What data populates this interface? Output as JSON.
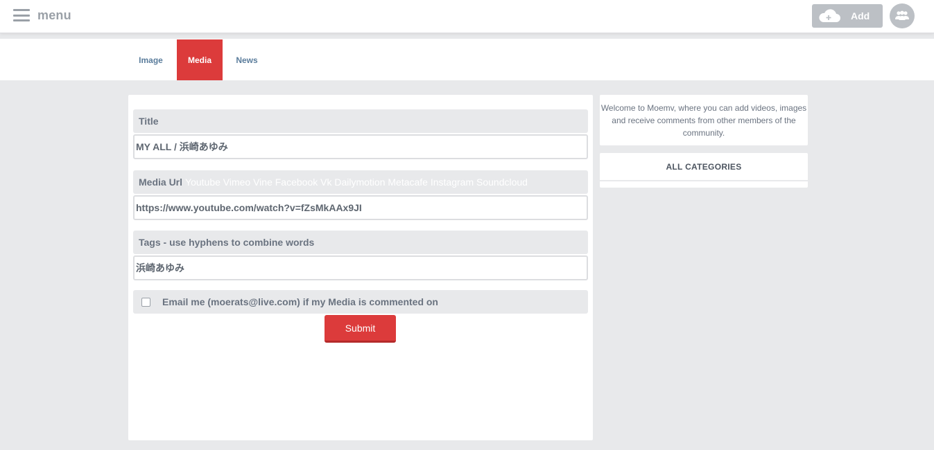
{
  "header": {
    "menu_label": "menu",
    "menu_icon": "hamburger-icon",
    "add_label": "Add",
    "add_icon": "cloud-plus-icon",
    "avatar_icon": "users-icon"
  },
  "tabs": [
    {
      "label": "Image",
      "active": false
    },
    {
      "label": "Media",
      "active": true
    },
    {
      "label": "News",
      "active": false
    }
  ],
  "form": {
    "title_label": "Title",
    "title_value": "MY ALL / 浜崎あゆみ",
    "media_url_label": "Media Url",
    "media_url_providers": "Youtube Vimeo Vine Facebook Vk Dailymotion Metacafe Instagram Soundcloud",
    "media_url_value": "https://www.youtube.com/watch?v=fZsMkAAx9JI",
    "tags_label": "Tags - use hyphens to combine words",
    "tags_value": "浜崎あゆみ",
    "email_label": "Email me (moerats@live.com) if my Media is commented on",
    "email_checked": false,
    "submit_label": "Submit"
  },
  "sidebar": {
    "welcome_text": "Welcome to Moemv, where you can add videos, images and receive comments from other members of the community.",
    "categories_label": "ALL CATEGORIES"
  },
  "colors": {
    "accent": "#dc3b3b",
    "background": "#e8e9eb",
    "link": "#5b7d9c"
  }
}
